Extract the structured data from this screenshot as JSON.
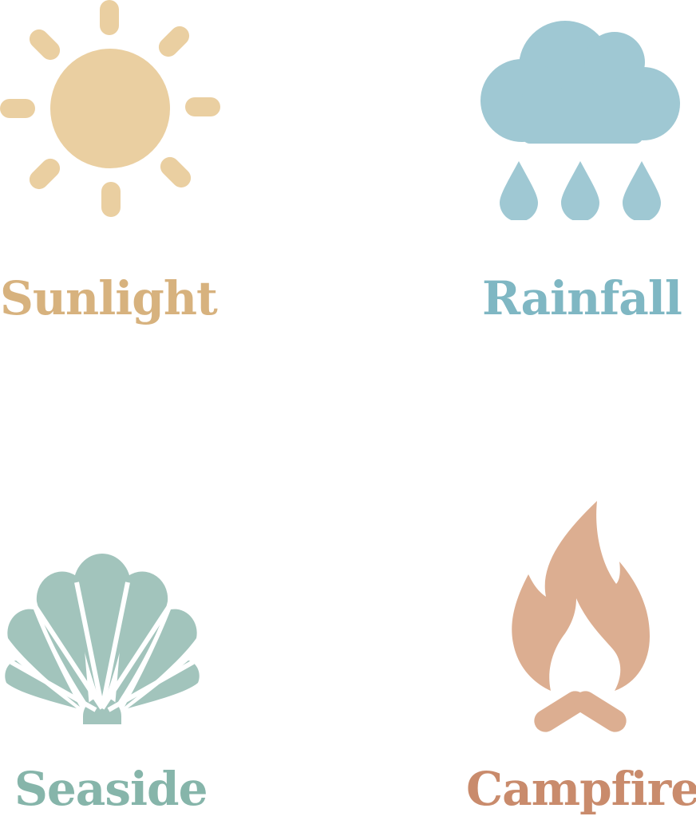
{
  "tiles": [
    {
      "label": "Sunlight",
      "icon": "sun-icon",
      "color": "#eacfa1",
      "text_color": "#d7b27e"
    },
    {
      "label": "Rainfall",
      "icon": "rain-cloud-icon",
      "color": "#9fc8d3",
      "text_color": "#7fb7c3"
    },
    {
      "label": "Seaside",
      "icon": "seashell-icon",
      "color": "#a2c4bc",
      "text_color": "#86b5aa"
    },
    {
      "label": "Campfire",
      "icon": "campfire-icon",
      "color": "#dcae91",
      "text_color": "#c98b6c"
    }
  ]
}
